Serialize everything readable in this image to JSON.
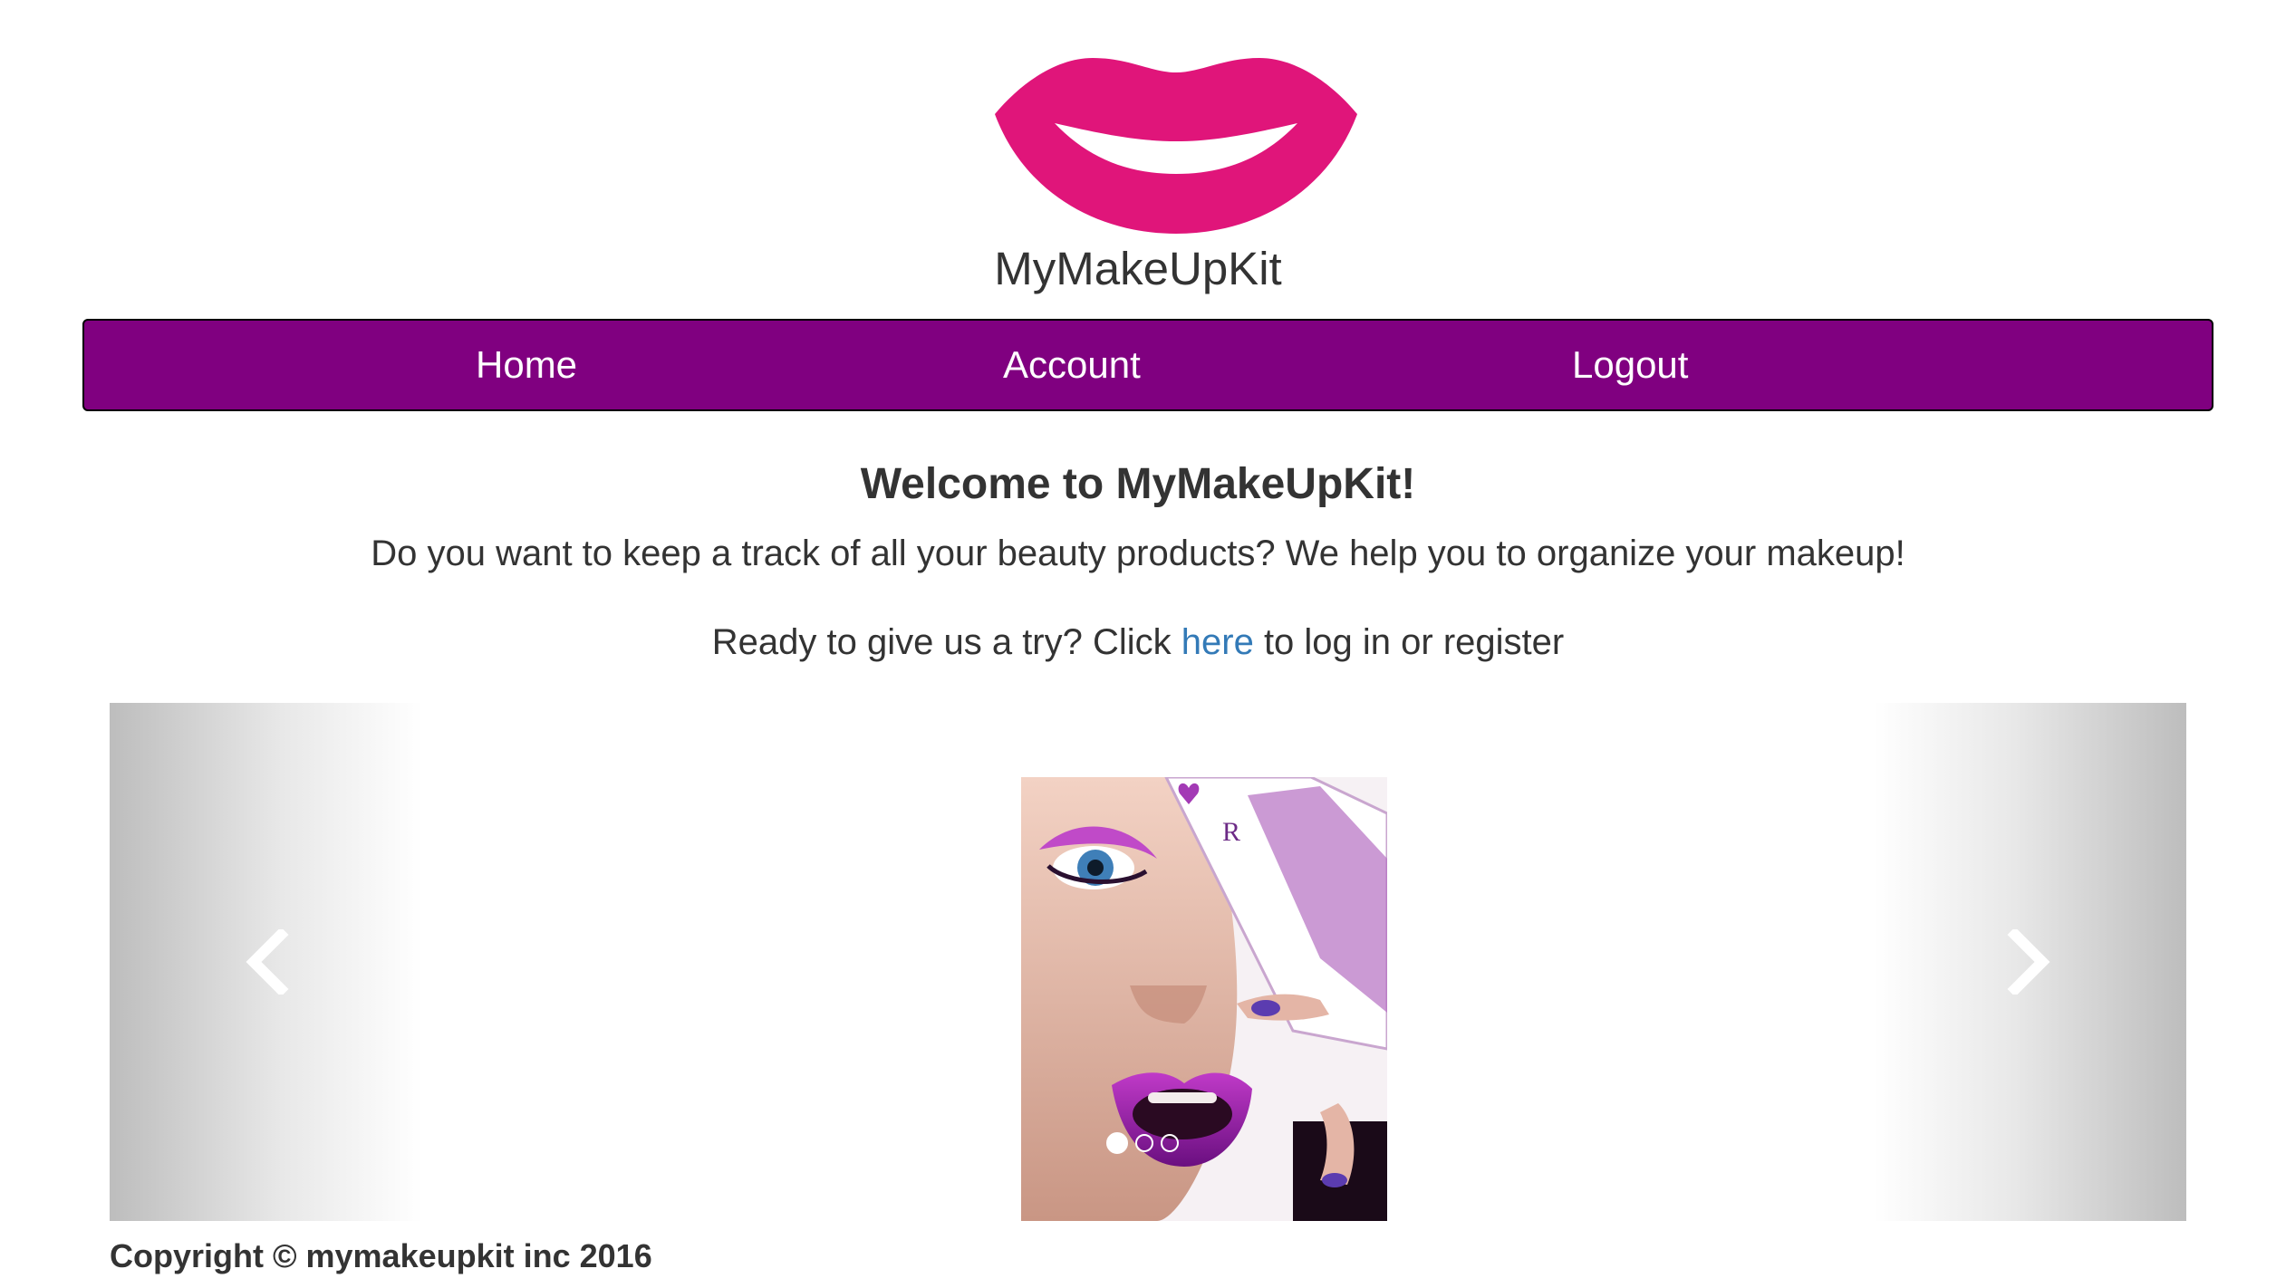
{
  "brand": {
    "logo_icon": "lips-logo-icon",
    "name": "MyMakeUpKit",
    "logo_color": "#e0157a"
  },
  "nav": {
    "background": "#800080",
    "items": [
      {
        "label": "Home"
      },
      {
        "label": "Account"
      },
      {
        "label": "Logout"
      }
    ]
  },
  "main": {
    "title": "Welcome to MyMakeUpKit!",
    "intro": "Do you want to keep a track of all your beauty products? We help you to organize your makeup!",
    "cta_before": "Ready to give us a try? Click ",
    "cta_link": "here",
    "cta_after": " to log in or register",
    "link_color": "#337ab7"
  },
  "carousel": {
    "prev_icon": "chevron-left-icon",
    "next_icon": "chevron-right-icon",
    "slide_count": 3,
    "active_slide": 1
  },
  "footer": {
    "copyright": "Copyright © mymakeupkit inc 2016"
  }
}
